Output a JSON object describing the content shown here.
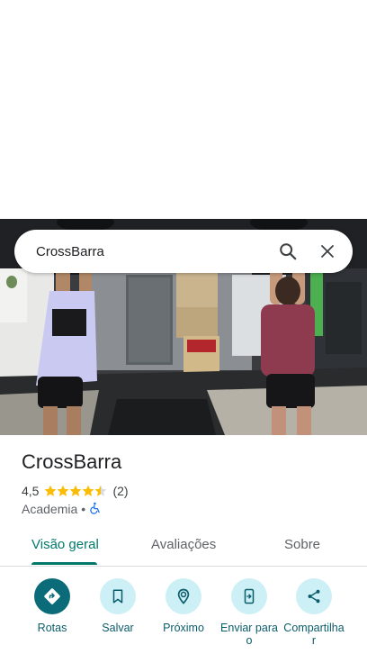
{
  "search": {
    "query": "CrossBarra"
  },
  "place": {
    "name": "CrossBarra",
    "rating": "4,5",
    "rating_value": 4.5,
    "review_count": "(2)",
    "category": "Academia",
    "separator": "•"
  },
  "tabs": [
    {
      "label": "Visão geral",
      "active": true
    },
    {
      "label": "Avaliações",
      "active": false
    },
    {
      "label": "Sobre",
      "active": false
    }
  ],
  "actions": [
    {
      "label": "Rotas",
      "icon": "directions-icon"
    },
    {
      "label": "Salvar",
      "icon": "bookmark-icon"
    },
    {
      "label": "Próximo",
      "icon": "nearby-icon"
    },
    {
      "label": "Enviar para o",
      "icon": "send-to-phone-icon"
    },
    {
      "label": "Compartilhar",
      "icon": "share-icon"
    }
  ],
  "colors": {
    "accent": "#00796b",
    "star": "#fbbc04",
    "action_bg": "#cdf0f6",
    "primary_action_bg": "#0b6b78",
    "accessibility": "#1a73e8"
  }
}
